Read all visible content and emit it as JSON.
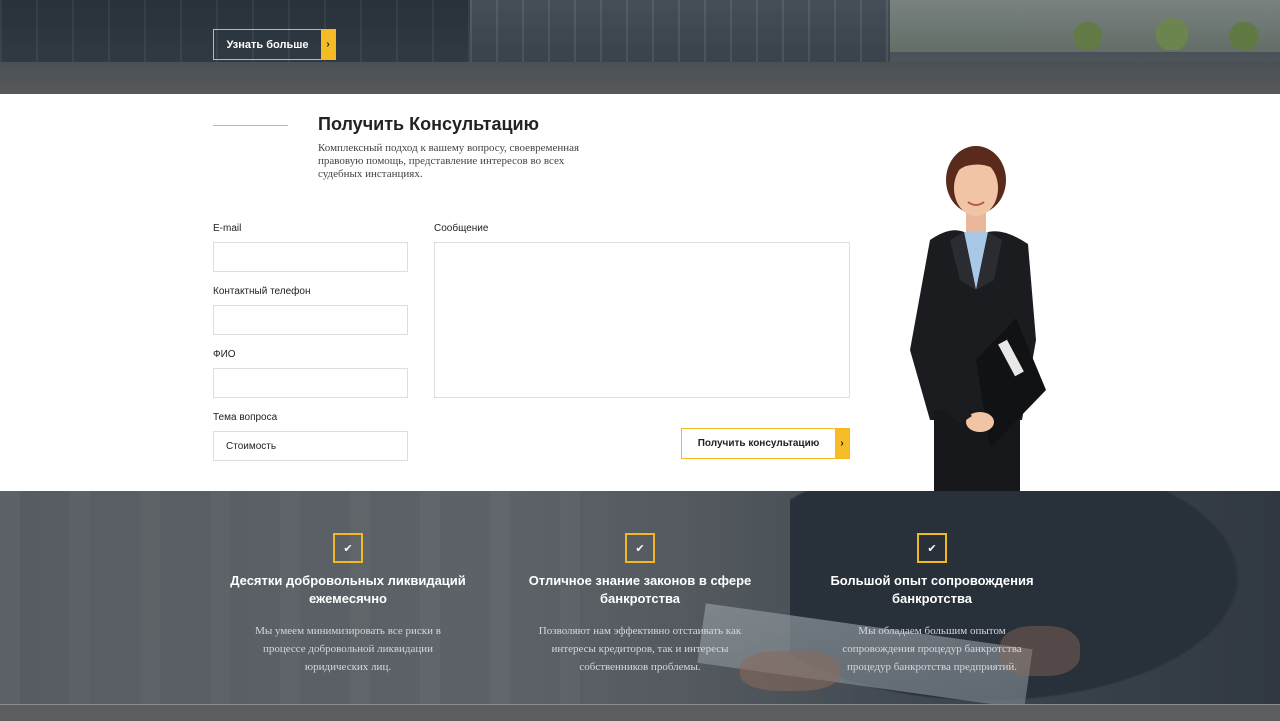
{
  "hero": {
    "button_label": "Узнать больше",
    "arrow_glyph": "›"
  },
  "consult": {
    "title": "Получить Консультацию",
    "description": "Комплексный подход к вашему вопросу, своевременная правовую помощь, представление интересов во всех судебных инстанциях.",
    "form": {
      "email_label": "E-mail",
      "email_value": "",
      "phone_label": "Контактный телефон",
      "phone_value": "",
      "name_label": "ФИО",
      "name_value": "",
      "topic_label": "Тема вопроса",
      "topic_value": "Стоимость",
      "message_label": "Сообщение",
      "message_value": "",
      "submit_label": "Получить консультацию"
    }
  },
  "features": [
    {
      "icon": "check-icon",
      "title": "Десятки добровольных ликвидаций ежемесячно",
      "text": "Мы умеем минимизировать все риски в процессе добровольной ликвидации юридических лиц."
    },
    {
      "icon": "check-icon",
      "title": "Отличное знание законов в сфере банкротства",
      "text": "Позволяют нам эффективно отстаивать как интересы кредиторов, так и интересы собственников проблемы."
    },
    {
      "icon": "check-icon",
      "title": "Большой опыт сопровождения банкротства",
      "text": "Мы обладаем большим опытом сопровождения процедур банкротства процедур банкротства предприятий."
    }
  ],
  "colors": {
    "accent": "#f6bc25",
    "text": "#222222",
    "band_overlay": "#5f656b"
  }
}
